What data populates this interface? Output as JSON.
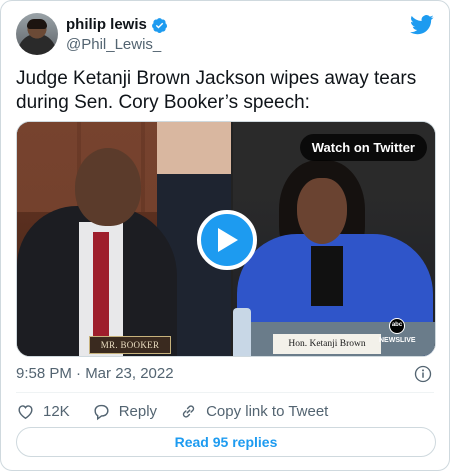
{
  "author": {
    "display_name": "philip lewis",
    "handle": "@Phil_Lewis_",
    "verified": true,
    "avatar_icon": "avatar-photo"
  },
  "tweet": {
    "text": "Judge Ketanji Brown Jackson wipes away tears during Sen. Cory Booker’s speech:",
    "timestamp": "9:58 PM · Mar 23, 2022"
  },
  "media": {
    "watch_label": "Watch on Twitter",
    "play_icon": "play-icon",
    "left_nameplate": "MR. BOOKER",
    "right_nameplate": "Hon. Ketanji Brown Jackson",
    "network_logo_top": "abc",
    "network_logo_bottom": "NEWSLIVE"
  },
  "actions": {
    "likes_count": "12K",
    "reply_label": "Reply",
    "copy_link_label": "Copy link to Tweet"
  },
  "footer": {
    "read_replies_label": "Read 95 replies"
  },
  "colors": {
    "brand": "#1d9bf0",
    "text_primary": "#0f1419",
    "text_secondary": "#536471",
    "border": "#cfd9de"
  }
}
